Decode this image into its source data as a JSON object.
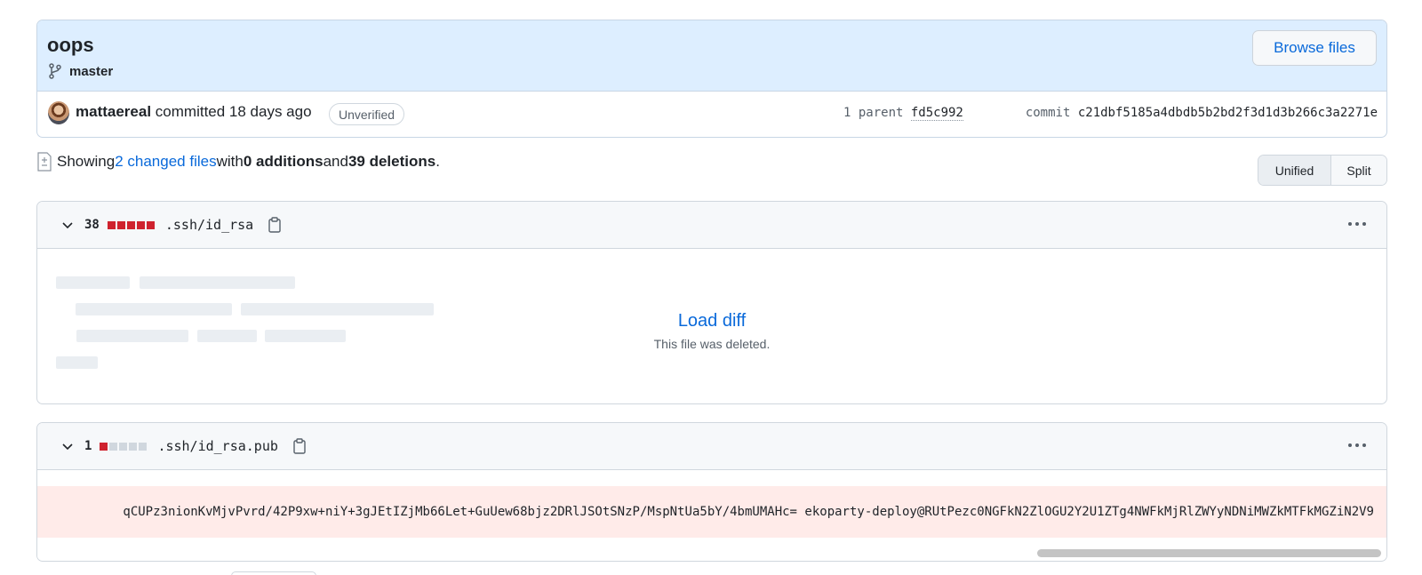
{
  "commit": {
    "title": "oops",
    "branch": "master",
    "browse_label": "Browse files",
    "author": "mattaereal",
    "action": " committed 18 days ago",
    "verification": "Unverified",
    "parent_label": "1 parent ",
    "parent_sha": "fd5c992",
    "commit_label": "commit ",
    "commit_sha": "c21dbf5185a4dbdb5b2bd2f3d1d3b266c3a2271e",
    "icons": [
      "git-branch-icon",
      "avatar"
    ]
  },
  "summary": {
    "prefix": "Showing ",
    "changed_files": "2 changed files",
    "with": " with ",
    "additions": "0 additions",
    "and": " and ",
    "deletions": "39 deletions",
    "suffix": "."
  },
  "view_toggle": {
    "unified": "Unified",
    "split": "Split",
    "selected": "Unified"
  },
  "files": [
    {
      "count": "38",
      "blocks": [
        "del",
        "del",
        "del",
        "del",
        "del"
      ],
      "name": ".ssh/id_rsa",
      "load_diff": "Load diff",
      "note": "This file was deleted."
    },
    {
      "count": "1",
      "blocks": [
        "del",
        "neu",
        "neu",
        "neu",
        "neu"
      ],
      "name": ".ssh/id_rsa.pub",
      "code": "qCUPz3nionKvMjvPvrd/42P9xw+niY+3gJEtIZjMb66Let+GuUew68bjz2DRlJSOtSNzP/MspNtUa5bY/4bmUMAHc= ekoparty-deploy@RUtPezc0NGFkN2ZlOGU2Y2U1ZTg4NWFkMjRlZWYyNDNiMWZkMTFkMGZiN2V9"
    }
  ],
  "colors": {
    "header_bg": "#ddeeff",
    "link": "#0969da",
    "deletion": "#cf222e",
    "deleted_line_bg": "#ffebe9"
  }
}
